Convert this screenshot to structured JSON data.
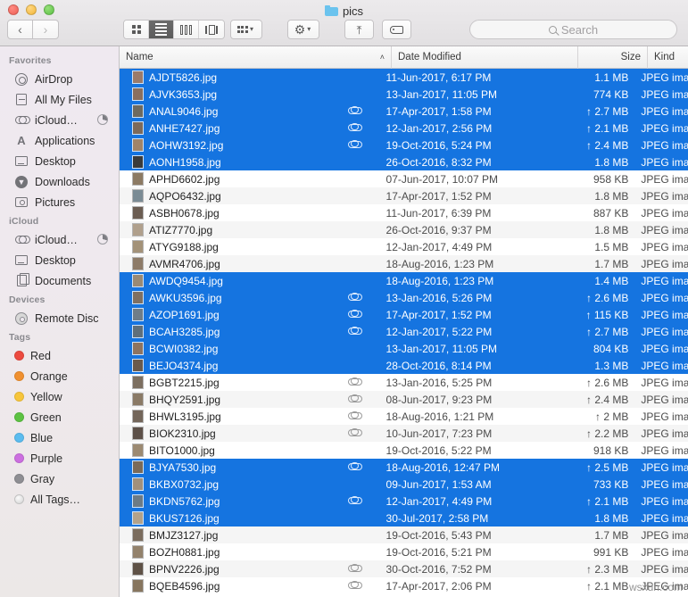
{
  "window": {
    "title": "pics",
    "traffic_lights": [
      "close",
      "minimize",
      "zoom"
    ]
  },
  "toolbar": {
    "back_label": "‹",
    "forward_label": "›",
    "view_icon_label": "icon-view",
    "view_list_label": "list-view",
    "view_column_label": "column-view",
    "view_coverflow_label": "coverflow-view",
    "arrange_label": "arrange",
    "action_label": "action",
    "share_label": "share",
    "tag_label": "tag"
  },
  "search": {
    "placeholder": "Search",
    "value": ""
  },
  "sidebar": {
    "sections": [
      {
        "title": "Favorites",
        "items": [
          {
            "label": "AirDrop",
            "icon": "airdrop-icon"
          },
          {
            "label": "All My Files",
            "icon": "all-my-files-icon"
          },
          {
            "label": "iCloud…",
            "icon": "cloud-icon",
            "progress": true
          },
          {
            "label": "Applications",
            "icon": "applications-icon"
          },
          {
            "label": "Desktop",
            "icon": "desktop-icon"
          },
          {
            "label": "Downloads",
            "icon": "downloads-icon"
          },
          {
            "label": "Pictures",
            "icon": "pictures-icon"
          }
        ]
      },
      {
        "title": "iCloud",
        "items": [
          {
            "label": "iCloud…",
            "icon": "cloud-icon",
            "progress": true
          },
          {
            "label": "Desktop",
            "icon": "desktop-icon"
          },
          {
            "label": "Documents",
            "icon": "documents-icon"
          }
        ]
      },
      {
        "title": "Devices",
        "items": [
          {
            "label": "Remote Disc",
            "icon": "disc-icon"
          }
        ]
      },
      {
        "title": "Tags",
        "items": [
          {
            "label": "Red",
            "icon": "tag-dot-icon",
            "color": "#ec4a3f"
          },
          {
            "label": "Orange",
            "icon": "tag-dot-icon",
            "color": "#f09030"
          },
          {
            "label": "Yellow",
            "icon": "tag-dot-icon",
            "color": "#f7c53b"
          },
          {
            "label": "Green",
            "icon": "tag-dot-icon",
            "color": "#5cc242"
          },
          {
            "label": "Blue",
            "icon": "tag-dot-icon",
            "color": "#5bbcef"
          },
          {
            "label": "Purple",
            "icon": "tag-dot-icon",
            "color": "#cc6fe0"
          },
          {
            "label": "Gray",
            "icon": "tag-dot-icon",
            "color": "#8e8e93"
          },
          {
            "label": "All Tags…",
            "icon": "all-tags-icon",
            "color": "multi"
          }
        ]
      }
    ]
  },
  "file_list": {
    "columns": [
      {
        "key": "name",
        "label": "Name",
        "sorted": true,
        "sort_arrow": "˄"
      },
      {
        "key": "date",
        "label": "Date Modified"
      },
      {
        "key": "size",
        "label": "Size"
      },
      {
        "key": "kind",
        "label": "Kind"
      }
    ],
    "rows": [
      {
        "name": "AJDT5826.jpg",
        "date": "11-Jun-2017, 6:17 PM",
        "size": "1.1 MB",
        "kind": "JPEG ima",
        "cloud": false,
        "uploading": false,
        "selected": true
      },
      {
        "name": "AJVK3653.jpg",
        "date": "13-Jan-2017, 11:05 PM",
        "size": "774 KB",
        "kind": "JPEG ima",
        "cloud": false,
        "uploading": false,
        "selected": true
      },
      {
        "name": "ANAL9046.jpg",
        "date": "17-Apr-2017, 1:58 PM",
        "size": "2.7 MB",
        "kind": "JPEG ima",
        "cloud": true,
        "uploading": true,
        "selected": true
      },
      {
        "name": "ANHE7427.jpg",
        "date": "12-Jan-2017, 2:56 PM",
        "size": "2.1 MB",
        "kind": "JPEG ima",
        "cloud": true,
        "uploading": true,
        "selected": true
      },
      {
        "name": "AOHW3192.jpg",
        "date": "19-Oct-2016, 5:24 PM",
        "size": "2.4 MB",
        "kind": "JPEG ima",
        "cloud": true,
        "uploading": true,
        "selected": true
      },
      {
        "name": "AONH1958.jpg",
        "date": "26-Oct-2016, 8:32 PM",
        "size": "1.8 MB",
        "kind": "JPEG ima",
        "cloud": false,
        "uploading": false,
        "selected": true
      },
      {
        "name": "APHD6602.jpg",
        "date": "07-Jun-2017, 10:07 PM",
        "size": "958 KB",
        "kind": "JPEG ima",
        "cloud": false,
        "uploading": false,
        "selected": false
      },
      {
        "name": "AQPO6432.jpg",
        "date": "17-Apr-2017, 1:52 PM",
        "size": "1.8 MB",
        "kind": "JPEG ima",
        "cloud": false,
        "uploading": false,
        "selected": false
      },
      {
        "name": "ASBH0678.jpg",
        "date": "11-Jun-2017, 6:39 PM",
        "size": "887 KB",
        "kind": "JPEG ima",
        "cloud": false,
        "uploading": false,
        "selected": false
      },
      {
        "name": "ATIZ7770.jpg",
        "date": "26-Oct-2016, 9:37 PM",
        "size": "1.8 MB",
        "kind": "JPEG ima",
        "cloud": false,
        "uploading": false,
        "selected": false
      },
      {
        "name": "ATYG9188.jpg",
        "date": "12-Jan-2017, 4:49 PM",
        "size": "1.5 MB",
        "kind": "JPEG ima",
        "cloud": false,
        "uploading": false,
        "selected": false
      },
      {
        "name": "AVMR4706.jpg",
        "date": "18-Aug-2016, 1:23 PM",
        "size": "1.7 MB",
        "kind": "JPEG ima",
        "cloud": false,
        "uploading": false,
        "selected": false
      },
      {
        "name": "AWDQ9454.jpg",
        "date": "18-Aug-2016, 1:23 PM",
        "size": "1.4 MB",
        "kind": "JPEG ima",
        "cloud": false,
        "uploading": false,
        "selected": true
      },
      {
        "name": "AWKU3596.jpg",
        "date": "13-Jan-2016, 5:26 PM",
        "size": "2.6 MB",
        "kind": "JPEG ima",
        "cloud": true,
        "uploading": true,
        "selected": true
      },
      {
        "name": "AZOP1691.jpg",
        "date": "17-Apr-2017, 1:52 PM",
        "size": "115 KB",
        "kind": "JPEG ima",
        "cloud": true,
        "uploading": true,
        "selected": true
      },
      {
        "name": "BCAH3285.jpg",
        "date": "12-Jan-2017, 5:22 PM",
        "size": "2.7 MB",
        "kind": "JPEG ima",
        "cloud": true,
        "uploading": true,
        "selected": true
      },
      {
        "name": "BCWI0382.jpg",
        "date": "13-Jan-2017, 11:05 PM",
        "size": "804 KB",
        "kind": "JPEG ima",
        "cloud": false,
        "uploading": false,
        "selected": true
      },
      {
        "name": "BEJO4374.jpg",
        "date": "28-Oct-2016, 8:14 PM",
        "size": "1.3 MB",
        "kind": "JPEG ima",
        "cloud": false,
        "uploading": false,
        "selected": true
      },
      {
        "name": "BGBT2215.jpg",
        "date": "13-Jan-2016, 5:25 PM",
        "size": "2.6 MB",
        "kind": "JPEG ima",
        "cloud": true,
        "uploading": true,
        "selected": false
      },
      {
        "name": "BHQY2591.jpg",
        "date": "08-Jun-2017, 9:23 PM",
        "size": "2.4 MB",
        "kind": "JPEG ima",
        "cloud": true,
        "uploading": true,
        "selected": false
      },
      {
        "name": "BHWL3195.jpg",
        "date": "18-Aug-2016, 1:21 PM",
        "size": "2 MB",
        "kind": "JPEG ima",
        "cloud": true,
        "uploading": true,
        "selected": false
      },
      {
        "name": "BIOK2310.jpg",
        "date": "10-Jun-2017, 7:23 PM",
        "size": "2.2 MB",
        "kind": "JPEG ima",
        "cloud": true,
        "uploading": true,
        "selected": false
      },
      {
        "name": "BITO1000.jpg",
        "date": "19-Oct-2016, 5:22 PM",
        "size": "918 KB",
        "kind": "JPEG ima",
        "cloud": false,
        "uploading": false,
        "selected": false
      },
      {
        "name": "BJYA7530.jpg",
        "date": "18-Aug-2016, 12:47 PM",
        "size": "2.5 MB",
        "kind": "JPEG ima",
        "cloud": true,
        "uploading": true,
        "selected": true
      },
      {
        "name": "BKBX0732.jpg",
        "date": "09-Jun-2017, 1:53 AM",
        "size": "733 KB",
        "kind": "JPEG ima",
        "cloud": false,
        "uploading": false,
        "selected": true
      },
      {
        "name": "BKDN5762.jpg",
        "date": "12-Jan-2017, 4:49 PM",
        "size": "2.1 MB",
        "kind": "JPEG ima",
        "cloud": true,
        "uploading": true,
        "selected": true
      },
      {
        "name": "BKUS7126.jpg",
        "date": "30-Jul-2017, 2:58 PM",
        "size": "1.8 MB",
        "kind": "JPEG ima",
        "cloud": false,
        "uploading": false,
        "selected": true
      },
      {
        "name": "BMJZ3127.jpg",
        "date": "19-Oct-2016, 5:43 PM",
        "size": "1.7 MB",
        "kind": "JPEG ima",
        "cloud": false,
        "uploading": false,
        "selected": false
      },
      {
        "name": "BOZH0881.jpg",
        "date": "19-Oct-2016, 5:21 PM",
        "size": "991 KB",
        "kind": "JPEG ima",
        "cloud": false,
        "uploading": false,
        "selected": false
      },
      {
        "name": "BPNV2226.jpg",
        "date": "30-Oct-2016, 7:52 PM",
        "size": "2.3 MB",
        "kind": "JPEG ima",
        "cloud": true,
        "uploading": true,
        "selected": false
      },
      {
        "name": "BQEB4596.jpg",
        "date": "17-Apr-2017, 2:06 PM",
        "size": "2.1 MB",
        "kind": "JPEG ima",
        "cloud": true,
        "uploading": true,
        "selected": false
      }
    ],
    "upload_arrow": "↑"
  },
  "watermark": "wsxdn.com",
  "colors": {
    "selection_blue": "#1574e0",
    "sidebar_bg": "#efe9f0",
    "titlebar_bg": "#eceaec"
  }
}
